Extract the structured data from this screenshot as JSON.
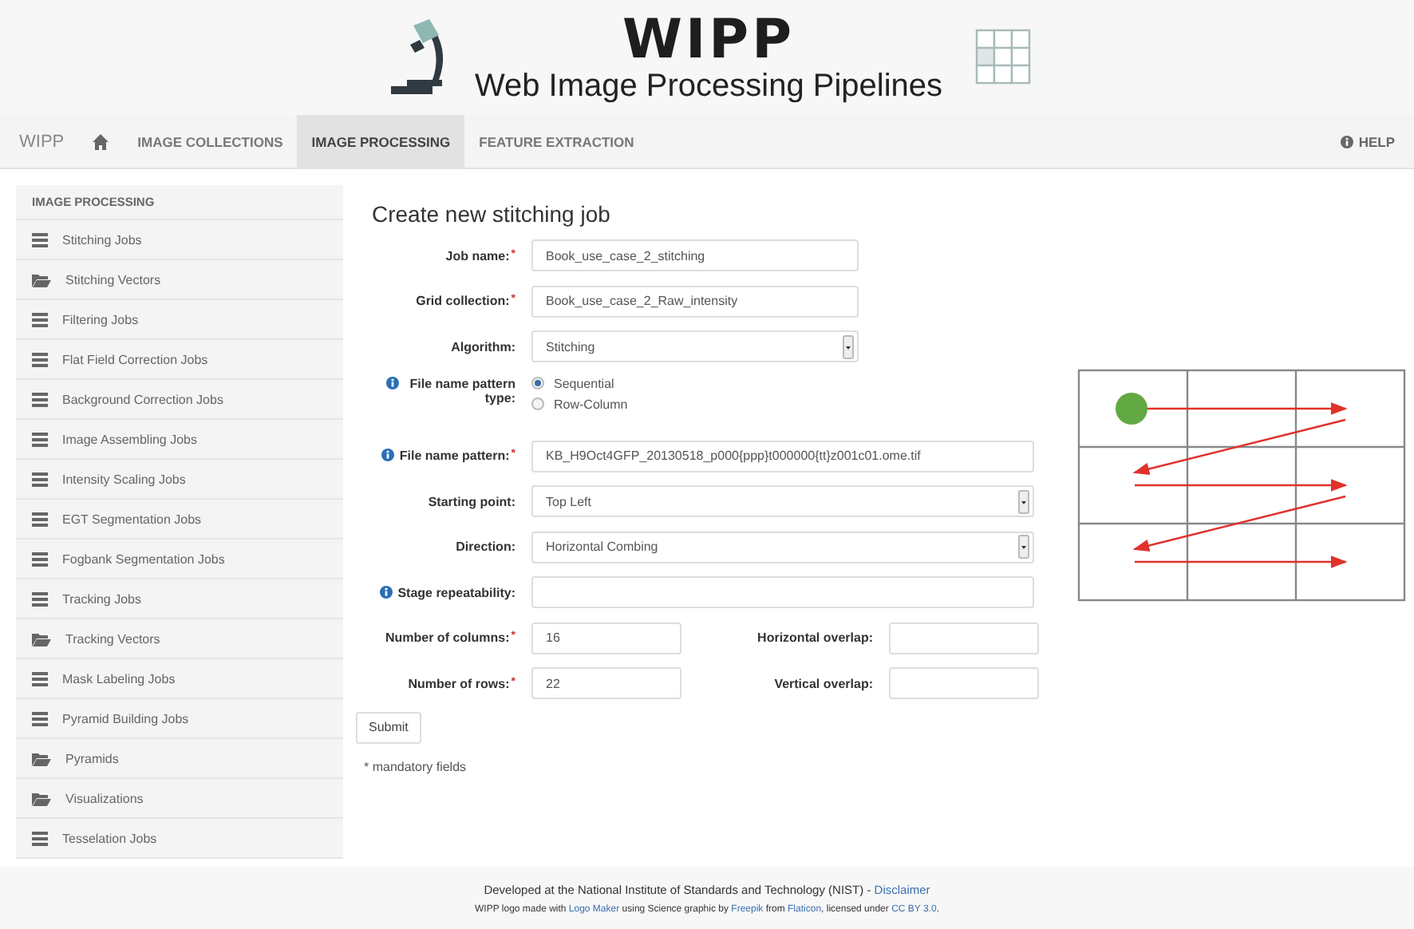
{
  "header": {
    "title": "WIPP",
    "subtitle": "Web Image Processing Pipelines"
  },
  "nav": {
    "items": [
      {
        "kind": "brand",
        "label": "WIPP",
        "selected": false
      },
      {
        "kind": "home",
        "selected": false
      },
      {
        "kind": "link",
        "label": "IMAGE COLLECTIONS",
        "selected": false
      },
      {
        "kind": "link",
        "label": "IMAGE PROCESSING",
        "selected": true
      },
      {
        "kind": "link",
        "label": "FEATURE EXTRACTION",
        "selected": false
      }
    ],
    "help": "HELP"
  },
  "sidebar": {
    "heading": "IMAGE PROCESSING",
    "items": [
      {
        "kind": "list",
        "label": "Stitching Jobs"
      },
      {
        "kind": "folder",
        "label": "Stitching Vectors"
      },
      {
        "kind": "list",
        "label": "Filtering Jobs"
      },
      {
        "kind": "list",
        "label": "Flat Field Correction Jobs"
      },
      {
        "kind": "list",
        "label": "Background Correction Jobs"
      },
      {
        "kind": "list",
        "label": "Image Assembling Jobs"
      },
      {
        "kind": "list",
        "label": "Intensity Scaling Jobs"
      },
      {
        "kind": "list",
        "label": "EGT Segmentation Jobs"
      },
      {
        "kind": "list",
        "label": "Fogbank Segmentation Jobs"
      },
      {
        "kind": "list",
        "label": "Tracking Jobs"
      },
      {
        "kind": "folder",
        "label": "Tracking Vectors"
      },
      {
        "kind": "list",
        "label": "Mask Labeling Jobs"
      },
      {
        "kind": "list",
        "label": "Pyramid Building Jobs"
      },
      {
        "kind": "folder",
        "label": "Pyramids"
      },
      {
        "kind": "folder",
        "label": "Visualizations"
      },
      {
        "kind": "list",
        "label": "Tesselation Jobs"
      }
    ]
  },
  "form": {
    "title": "Create new stitching job",
    "fields": [
      {
        "kind": "text",
        "label": "Job name:",
        "required": true,
        "info": false,
        "value": "Book_use_case_2_stitching"
      },
      {
        "kind": "text",
        "label": "Grid collection:",
        "required": true,
        "info": false,
        "value": "Book_use_case_2_Raw_intensity"
      },
      {
        "kind": "select",
        "label": "Algorithm:",
        "required": false,
        "info": false,
        "value": "Stitching"
      },
      {
        "kind": "radio",
        "label": "File name pattern type:",
        "required": false,
        "info": true,
        "options": [
          {
            "label": "Sequential",
            "selected": true
          },
          {
            "label": "Row-Column",
            "selected": false
          }
        ]
      },
      {
        "kind": "text",
        "label": "File name pattern:",
        "required": true,
        "info": true,
        "value": "KB_H9Oct4GFP_20130518_p000{ppp}t000000{tt}z001c01.ome.tif"
      },
      {
        "kind": "select",
        "label": "Starting point:",
        "required": false,
        "info": false,
        "value": "Top Left"
      },
      {
        "kind": "select",
        "label": "Direction:",
        "required": false,
        "info": false,
        "value": "Horizontal Combing"
      },
      {
        "kind": "text",
        "label": "Stage repeatability:",
        "required": false,
        "info": true
      },
      {
        "kind": "pair",
        "left": {
          "label": "Number of columns:",
          "required": true,
          "value": "16"
        },
        "right": {
          "label": "Horizontal overlap:",
          "required": false
        }
      },
      {
        "kind": "pair",
        "left": {
          "label": "Number of rows:",
          "required": true,
          "value": "22"
        },
        "right": {
          "label": "Vertical overlap:",
          "required": false
        }
      }
    ],
    "required_mark": "*",
    "submit": "Submit",
    "note": "* mandatory fields"
  },
  "footer": {
    "lines": [
      [
        {
          "text": "Developed at the National Institute of Standards and Technology (NIST) - ",
          "link": false
        },
        {
          "text": "Disclaimer",
          "link": true
        }
      ],
      [
        {
          "text": "WIPP logo made with ",
          "link": false
        },
        {
          "text": "Logo Maker",
          "link": true
        },
        {
          "text": " using Science graphic by ",
          "link": false
        },
        {
          "text": "Freepik",
          "link": true
        },
        {
          "text": " from ",
          "link": false
        },
        {
          "text": "Flaticon",
          "link": true
        },
        {
          "text": ", licensed under ",
          "link": false
        },
        {
          "text": "CC BY 3.0",
          "link": true
        },
        {
          "text": ".",
          "link": false
        }
      ]
    ]
  }
}
